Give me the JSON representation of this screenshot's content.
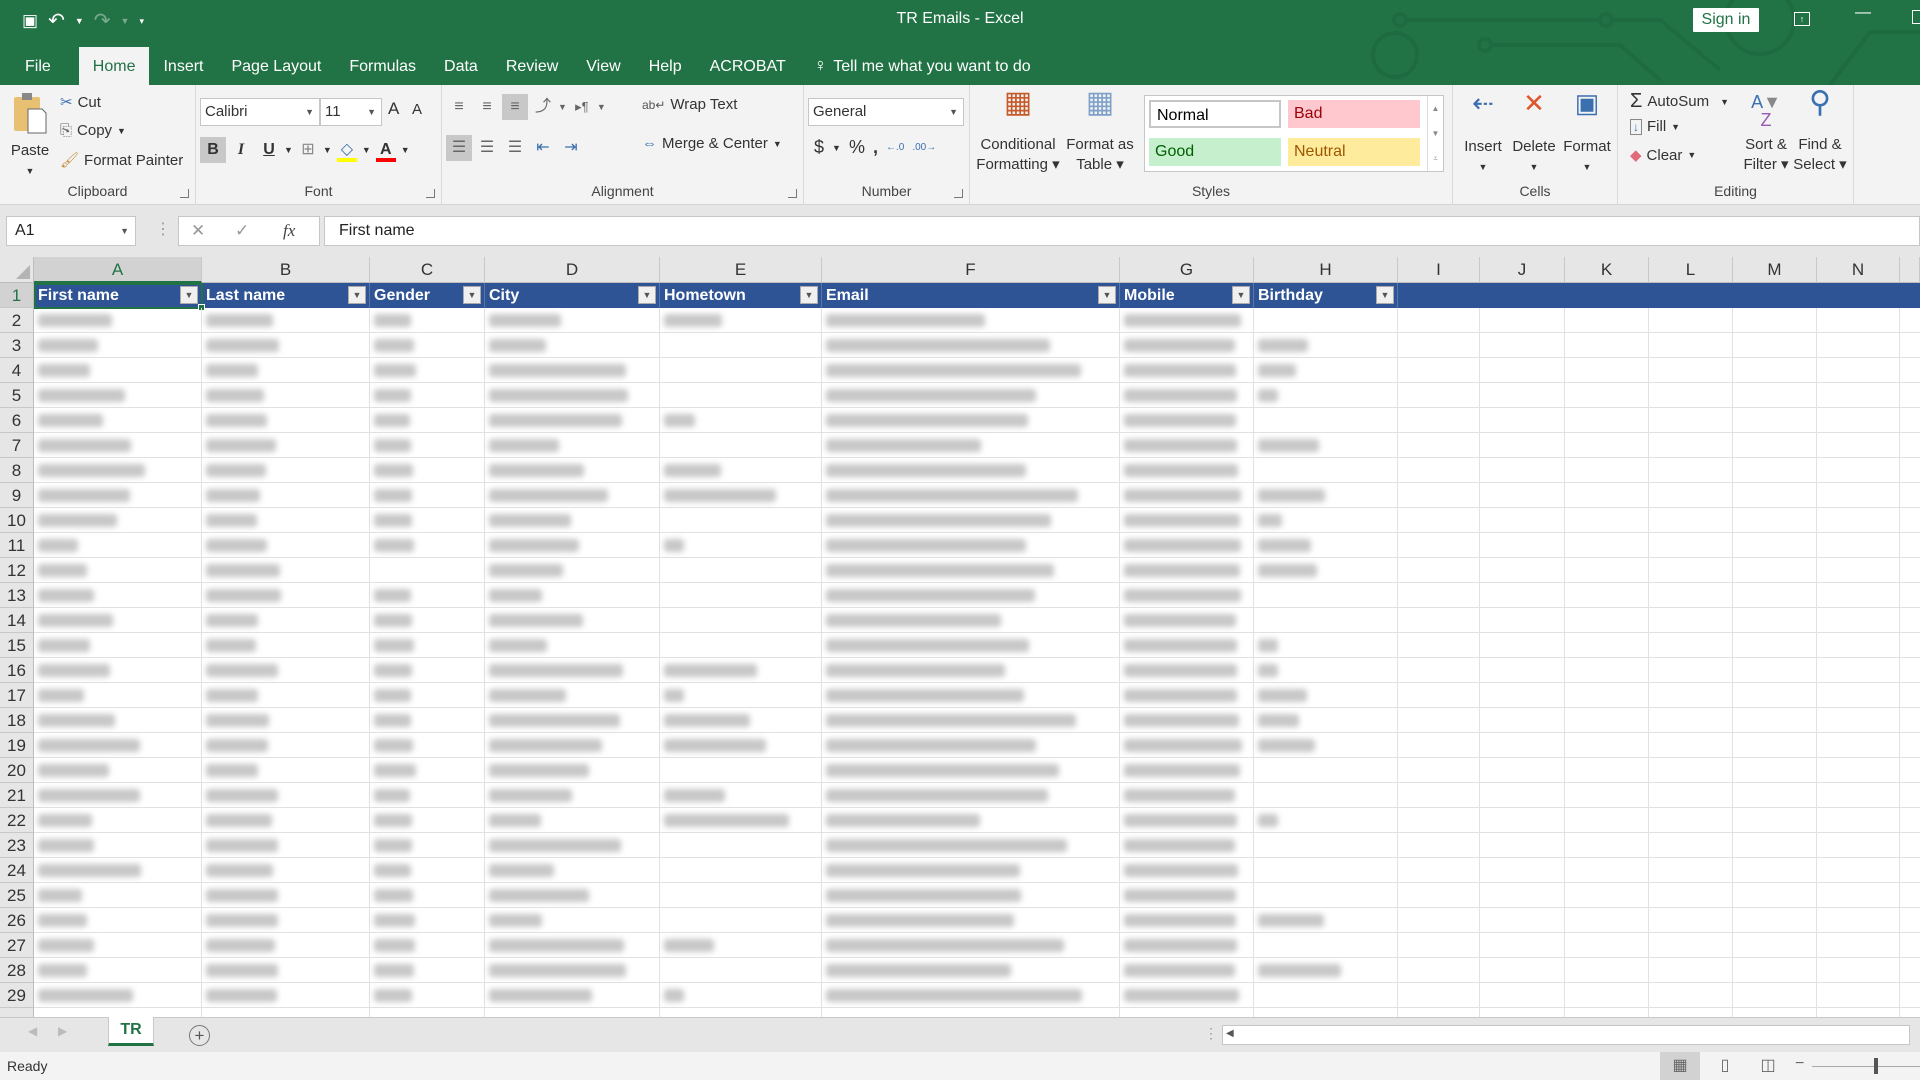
{
  "window": {
    "title": "TR Emails  -  Excel",
    "sign_in": "Sign in"
  },
  "qat": {
    "save_icon": "💾",
    "undo_icon": "↶",
    "redo_icon": "↷",
    "customize_icon": "▾"
  },
  "tabs": [
    {
      "label": "File"
    },
    {
      "label": "Home",
      "active": true
    },
    {
      "label": "Insert"
    },
    {
      "label": "Page Layout"
    },
    {
      "label": "Formulas"
    },
    {
      "label": "Data"
    },
    {
      "label": "Review"
    },
    {
      "label": "View"
    },
    {
      "label": "Help"
    },
    {
      "label": "ACROBAT"
    }
  ],
  "tell_me": "Tell me what you want to do",
  "ribbon": {
    "clipboard": {
      "label": "Clipboard",
      "paste": "Paste",
      "cut": "Cut",
      "copy": "Copy",
      "format_painter": "Format Painter"
    },
    "font": {
      "label": "Font",
      "font_name": "Calibri",
      "font_size": "11",
      "bold": "B",
      "italic": "I",
      "underline": "U",
      "grow": "A",
      "shrink": "A",
      "fill_color": "#ffff00",
      "font_color": "#ff0000"
    },
    "alignment": {
      "label": "Alignment",
      "wrap_text": "Wrap Text",
      "merge_center": "Merge & Center"
    },
    "number": {
      "label": "Number",
      "format": "General",
      "currency": "$",
      "percent": "%",
      "comma": ","
    },
    "styles": {
      "label": "Styles",
      "conditional_formatting": [
        "Conditional",
        "Formatting ▾"
      ],
      "format_as_table": [
        "Format as",
        "Table ▾"
      ],
      "cells": [
        {
          "label": "Normal",
          "bg": "#ffffff",
          "color": "#000000"
        },
        {
          "label": "Bad",
          "bg": "#ffc7ce",
          "color": "#9c0006"
        },
        {
          "label": "Good",
          "bg": "#c6efce",
          "color": "#006100"
        },
        {
          "label": "Neutral",
          "bg": "#ffeb9c",
          "color": "#9c5700"
        }
      ]
    },
    "cells": {
      "label": "Cells",
      "insert": "Insert",
      "delete": "Delete",
      "format": "Format"
    },
    "editing": {
      "label": "Editing",
      "autosum": "AutoSum",
      "fill": "Fill",
      "clear": "Clear",
      "sort_filter": [
        "Sort &",
        "Filter ▾"
      ],
      "find_select": [
        "Find &",
        "Select ▾"
      ]
    }
  },
  "formula_bar": {
    "name_box": "A1",
    "fx": "fx",
    "value": "First name"
  },
  "sheet": {
    "columns": [
      "A",
      "B",
      "C",
      "D",
      "E",
      "F",
      "G",
      "H",
      "I",
      "J",
      "K",
      "L",
      "M",
      "N"
    ],
    "active_column": "A",
    "active_row": 1,
    "header_row": [
      "First name",
      "Last name",
      "Gender",
      "City",
      "Hometown",
      "Email",
      "Mobile",
      "Birthday"
    ],
    "rows": [
      2,
      3,
      4,
      5,
      6,
      7,
      8,
      9,
      10,
      11,
      12,
      13,
      14,
      15,
      16,
      17,
      18,
      19,
      20,
      21,
      22,
      23,
      24,
      25,
      26,
      27,
      28,
      29
    ],
    "data_note": "cell contents in rows 2-29 are blurred/redacted",
    "accent": "#2f5496"
  },
  "sheet_tabs": [
    {
      "label": "TR",
      "active": true
    }
  ],
  "status": {
    "ready": "Ready"
  }
}
